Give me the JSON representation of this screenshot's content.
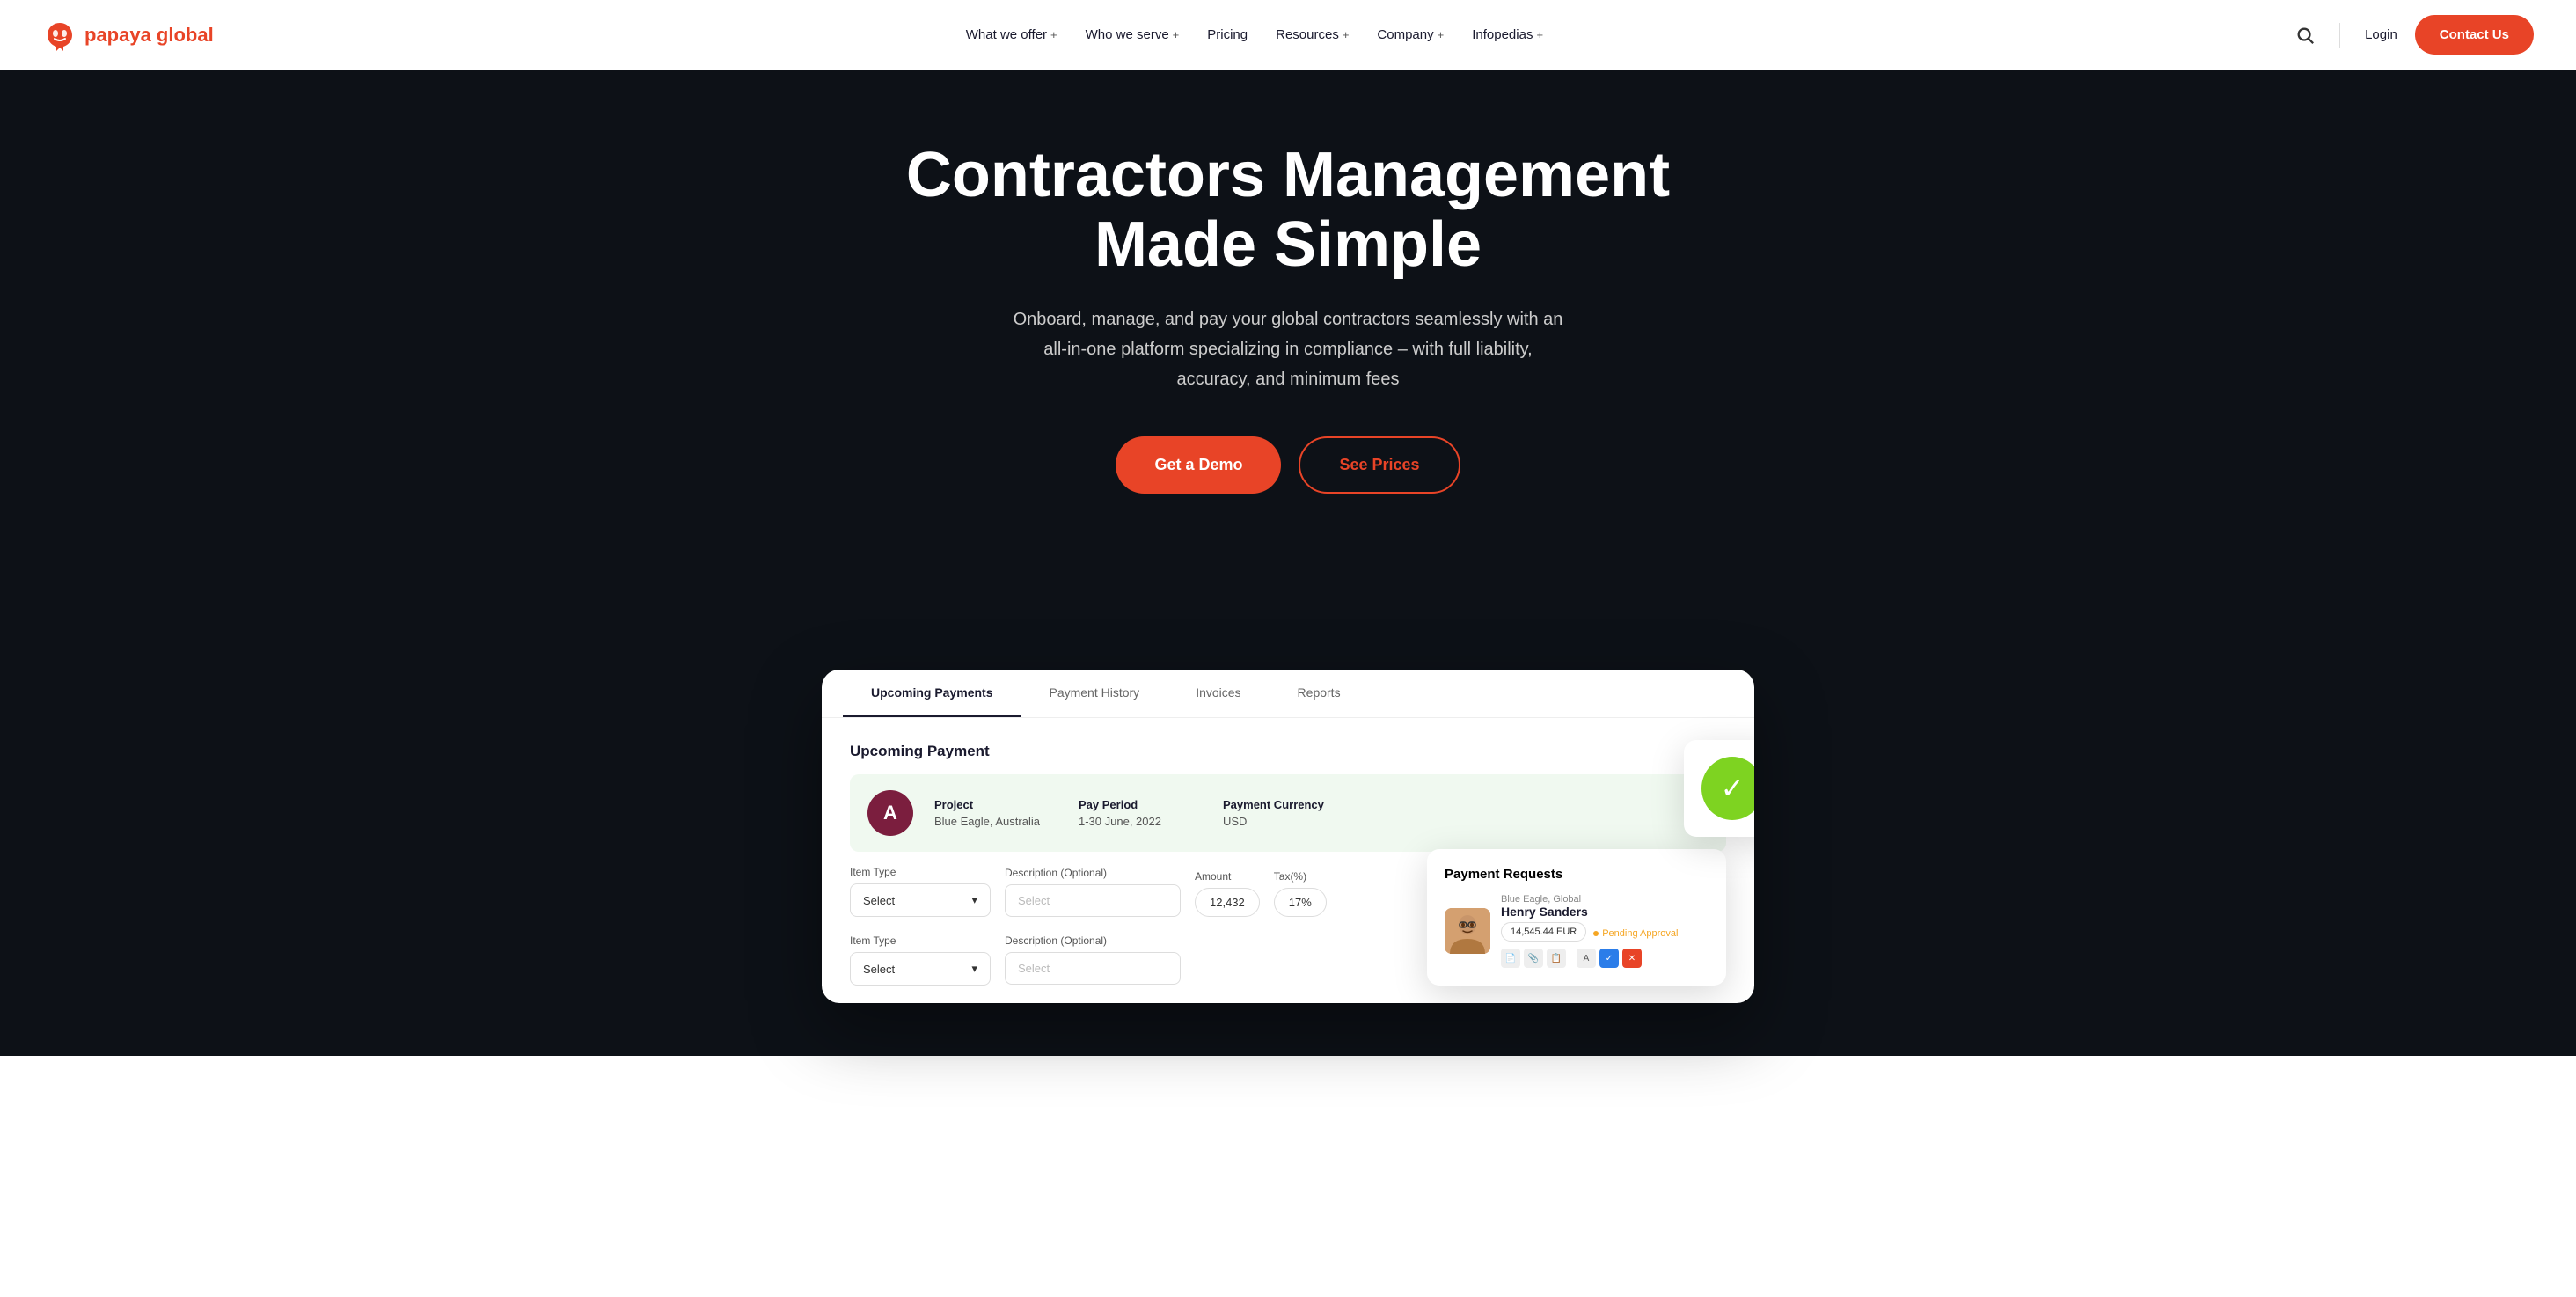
{
  "navbar": {
    "logo_text": "papaya global",
    "links": [
      {
        "label": "What we offer",
        "has_plus": true
      },
      {
        "label": "Who we serve",
        "has_plus": true
      },
      {
        "label": "Pricing",
        "has_plus": false
      },
      {
        "label": "Resources",
        "has_plus": true
      },
      {
        "label": "Company",
        "has_plus": true
      },
      {
        "label": "Infopedias",
        "has_plus": true
      }
    ],
    "login_label": "Login",
    "contact_label": "Contact Us"
  },
  "hero": {
    "heading": "Contractors Management Made Simple",
    "subtext": "Onboard, manage, and pay your global contractors seamlessly with an all-in-one platform specializing in compliance – with full liability, accuracy, and minimum fees",
    "btn_demo": "Get a Demo",
    "btn_prices": "See Prices"
  },
  "dashboard": {
    "tabs": [
      "Upcoming Payments",
      "Payment History",
      "Invoices",
      "Reports"
    ],
    "payment_section_title": "Upcoming Payment",
    "payment_row": {
      "avatar_letter": "A",
      "project_label": "Project",
      "project_value": "Blue Eagle, Australia",
      "pay_period_label": "Pay Period",
      "pay_period_value": "1-30 June, 2022",
      "currency_label": "Payment Currency",
      "currency_value": "USD"
    },
    "form_row1": {
      "item_type_label": "Item Type",
      "item_type_placeholder": "Select",
      "desc_label": "Description (Optional)",
      "desc_placeholder": "Select",
      "amount_label": "Amount",
      "amount_value": "12,432",
      "tax_label": "Tax(%)",
      "tax_value": "17%"
    },
    "form_row2": {
      "item_type_label": "Item Type",
      "item_type_placeholder": "Select",
      "desc_label": "Description (Optional)",
      "desc_placeholder": "Select"
    }
  },
  "payment_requests": {
    "title": "Payment Requests",
    "company": "Blue Eagle, Global",
    "name": "Henry Sanders",
    "amount": "14,545.44 EUR",
    "status": "Pending Approval"
  },
  "colors": {
    "brand_red": "#e84427",
    "dark_bg": "#0d1117",
    "avatar_dark": "#7b1e3e"
  }
}
